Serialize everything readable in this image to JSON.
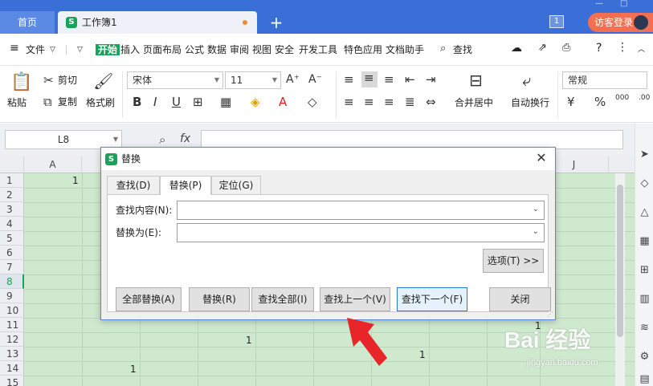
{
  "tabs": {
    "home": "首页",
    "document": "工作簿1",
    "new_tab": "+"
  },
  "titlebar": {
    "badge": "1",
    "login": "访客登录"
  },
  "menu": {
    "file": "文件",
    "items": [
      "开始",
      "插入",
      "页面布局",
      "公式",
      "数据",
      "审阅",
      "视图",
      "安全",
      "开发工具",
      "特色应用",
      "文档助手"
    ],
    "search": "查找"
  },
  "ribbon": {
    "paste": "粘贴",
    "cut": "剪切",
    "copy": "复制",
    "format_painter": "格式刷",
    "font_name": "宋体",
    "font_size": "11",
    "merge_center": "合并居中",
    "auto_wrap": "自动换行",
    "number_format": "常规"
  },
  "formula_bar": {
    "cell_ref": "L8",
    "fx": "fx"
  },
  "sheet": {
    "columns": [
      "A",
      "J"
    ],
    "rows": [
      "1",
      "2",
      "3",
      "4",
      "5",
      "6",
      "7",
      "8",
      "9",
      "10",
      "11",
      "12",
      "13",
      "14",
      "15"
    ],
    "selected_row": "8",
    "cell_values": [
      "1",
      "1",
      "1",
      "1",
      "1"
    ]
  },
  "dialog": {
    "title": "替换",
    "tabs": [
      "查找(D)",
      "替换(P)",
      "定位(G)"
    ],
    "active_tab": "替换(P)",
    "find_label": "查找内容(N):",
    "find_value": "",
    "replace_label": "替换为(E):",
    "replace_value": "",
    "options_button": "选项(T) >>",
    "buttons": {
      "replace_all": "全部替换(A)",
      "replace": "替换(R)",
      "find_all": "查找全部(I)",
      "find_prev": "查找上一个(V)",
      "find_next": "查找下一个(F)",
      "close": "关闭"
    }
  },
  "watermark": {
    "brand": "Bai 经验",
    "url": "jingyan.baidu.com"
  }
}
